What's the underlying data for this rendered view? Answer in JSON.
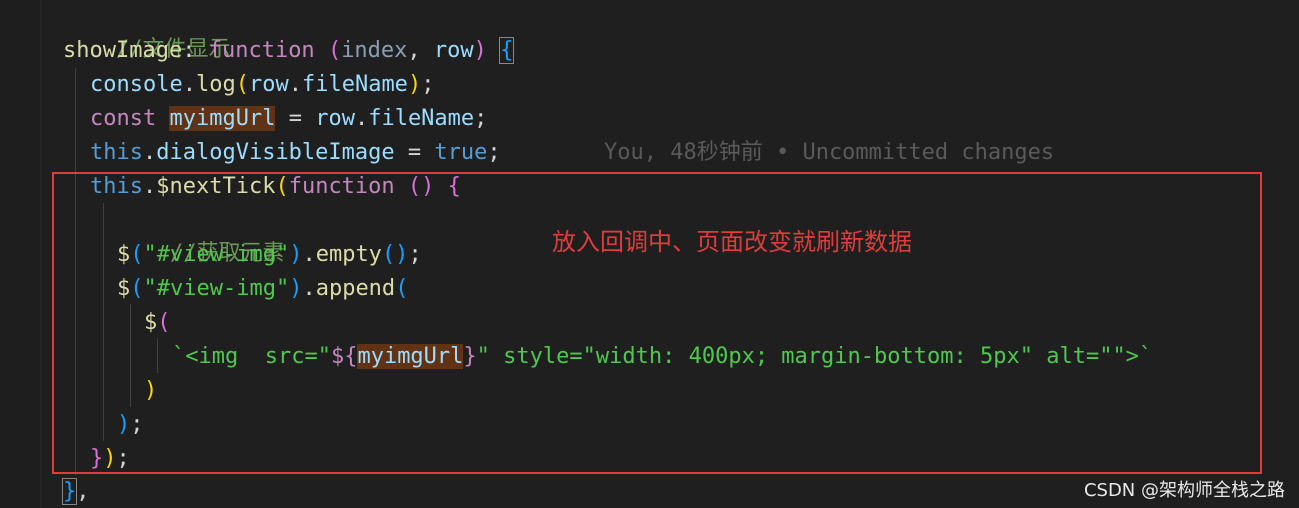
{
  "code": {
    "line1_comment": "//文件显示",
    "line2": {
      "name": "showImage",
      "colon": ": ",
      "keyword": "function",
      "space": " ",
      "open": "(",
      "param1": "index",
      "comma": ", ",
      "param2": "row",
      "close": ")",
      "space2": " ",
      "brace": "{"
    },
    "line3": {
      "obj": "console",
      "dot": ".",
      "method": "log",
      "open": "(",
      "arg_obj": "row",
      "dot2": ".",
      "arg_prop": "fileName",
      "close": ")",
      "semi": ";"
    },
    "line4": {
      "keyword": "const",
      "space": " ",
      "var": "myimgUrl",
      "eq": " = ",
      "obj": "row",
      "dot": ".",
      "prop": "fileName",
      "semi": ";"
    },
    "line5": {
      "this": "this",
      "dot": ".",
      "prop": "dialogVisibleImage",
      "eq": " = ",
      "value": "true",
      "semi": ";",
      "blame": "You, 48秒钟前 • Uncommitted changes"
    },
    "line6": {
      "this": "this",
      "dot": ".",
      "method": "$nextTick",
      "open": "(",
      "keyword": "function",
      "space": " ",
      "params": "()",
      "space2": " ",
      "brace": "{"
    },
    "line7_comment": "//获取元素",
    "line8": {
      "dollar": "$",
      "open": "(",
      "selector": "\"#view-img\"",
      "close": ")",
      "dot": ".",
      "method": "empty",
      "call": "()",
      "semi": ";"
    },
    "line9": {
      "dollar": "$",
      "open": "(",
      "selector": "\"#view-img\"",
      "close": ")",
      "dot": ".",
      "method": "append",
      "open2": "("
    },
    "line10": {
      "dollar": "$",
      "open": "("
    },
    "line11": {
      "tmpl_start": "`<img  src=\"",
      "interp_open": "${",
      "var": "myimgUrl",
      "interp_close": "}",
      "tmpl_end": "\" style=\"width: 400px; margin-bottom: 5px\" alt=\"\">`"
    },
    "line12": {
      "close": ")"
    },
    "line13": {
      "close": ")",
      "semi": ";"
    },
    "line14": {
      "brace": "}",
      "paren": ")",
      "semi": ";"
    },
    "line15": {
      "brace": "}",
      "comma": ","
    }
  },
  "annotation": "放入回调中、页面改变就刷新数据",
  "watermark": "CSDN @架构师全栈之路",
  "colors": {
    "background": "#1f1f1f",
    "annotation_red": "#e03c3c",
    "comment_green": "#6a9955",
    "keyword_pink": "#c586c0",
    "keyword_blue": "#569cd6",
    "function_yellow": "#dcdcaa",
    "string_orange": "#ce9178",
    "variable_blue": "#9cdcfe"
  }
}
